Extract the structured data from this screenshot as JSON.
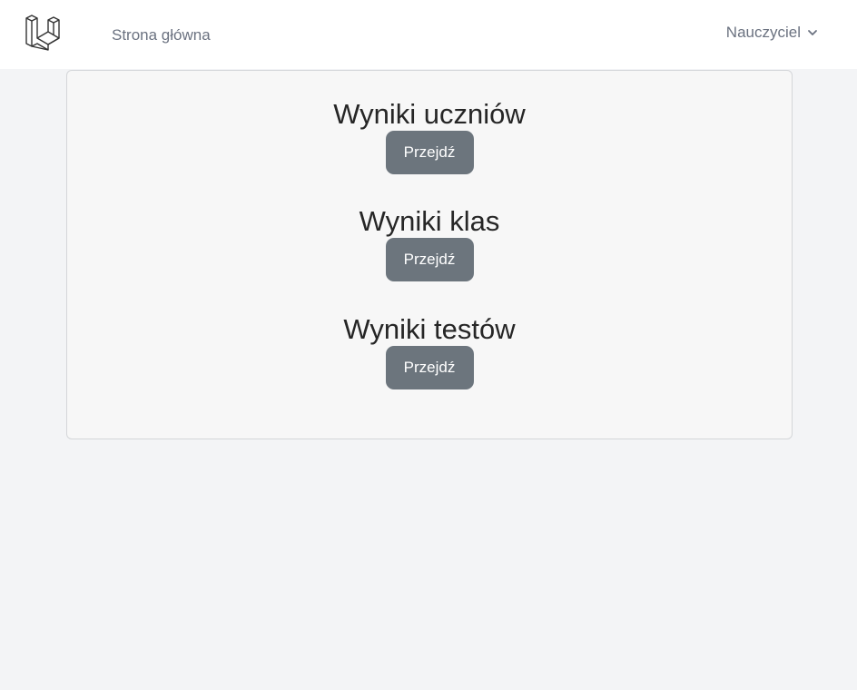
{
  "nav": {
    "logo_icon": "laravel-logo-icon",
    "home_label": "Strona główna",
    "user_label": "Nauczyciel",
    "user_menu_icon": "chevron-down-icon"
  },
  "sections": [
    {
      "title": "Wyniki uczniów",
      "button_label": "Przejdź"
    },
    {
      "title": "Wyniki klas",
      "button_label": "Przejdź"
    },
    {
      "title": "Wyniki testów",
      "button_label": "Przejdź"
    }
  ],
  "colors": {
    "page_background": "#f3f4f6",
    "navbar_background": "#ffffff",
    "card_background": "#f7f7f7",
    "button_background": "#6c757d",
    "button_text": "#ffffff"
  }
}
